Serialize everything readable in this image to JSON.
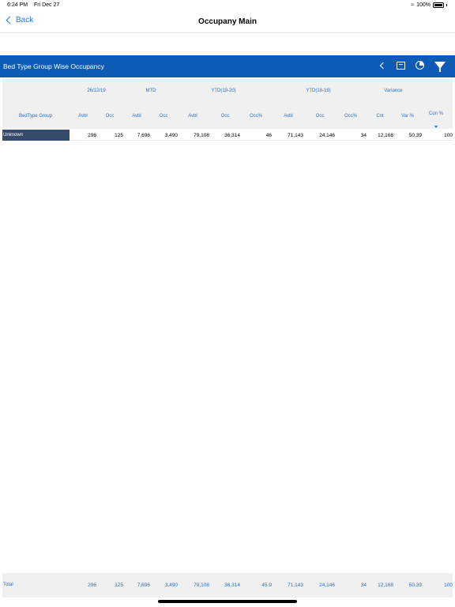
{
  "status_bar": {
    "time": "6:24 PM",
    "date": "Fri Dec 27",
    "battery": "100%"
  },
  "nav": {
    "back_label": "Back",
    "title": "Occupany Main"
  },
  "report": {
    "title": "Bed Type Group Wise Occupancy"
  },
  "table": {
    "groups": [
      "26/12/19",
      "MTD",
      "YTD(19-20)",
      "YTD(18-19)",
      "Variance"
    ],
    "columns": [
      "BedType Group",
      "Avbl",
      "Occ",
      "Avbl",
      "Occ",
      "Avbl",
      "Occ",
      "Occ%",
      "Avbl",
      "Occ",
      "Occ%",
      "Cnt",
      "Var %",
      "Con %"
    ],
    "rows": [
      {
        "label": "Unknown",
        "cells": [
          "296",
          "125",
          "7,696",
          "3,490",
          "79,108",
          "36,314",
          "46",
          "71,143",
          "24,146",
          "34",
          "12,168",
          "50.39",
          "100"
        ]
      }
    ],
    "total": {
      "label": "Total",
      "cells": [
        "296",
        "125",
        "7,696",
        "3,490",
        "79,108",
        "36,314",
        "45.9",
        "71,143",
        "24,146",
        "34",
        "12,168",
        "50.39",
        "100"
      ]
    }
  },
  "colors": {
    "header_blue": "#0d5bb5",
    "accent_blue": "#1a7cf4",
    "label_text": "#2a6fc0",
    "row_label_bg": "#364a6a"
  }
}
